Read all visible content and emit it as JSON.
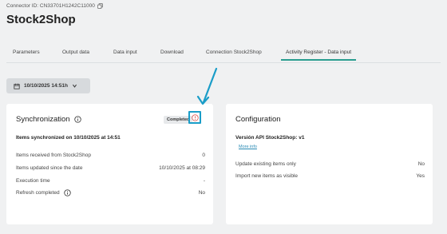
{
  "header": {
    "connector_id": "Connector ID: CN33701H1242C11000",
    "title": "Stock2Shop"
  },
  "tabs": [
    {
      "label": "Parameters"
    },
    {
      "label": "Output data"
    },
    {
      "label": "Data input"
    },
    {
      "label": "Download"
    },
    {
      "label": "Connection Stock2Shop"
    },
    {
      "label": "Activity Register - Data input",
      "active": true
    }
  ],
  "date_button": {
    "label": "10/10/2025 14:51h",
    "icon": "calendar-icon"
  },
  "sync_card": {
    "title": "Synchronization",
    "badge": "Completed",
    "synced_line": "Items synchronized on 10/10/2025 at 14:51",
    "rows": [
      {
        "label": "Items received from Stock2Shop",
        "value": "0"
      },
      {
        "label": "Items updated since the date",
        "value": "10/10/2025 at 08:29"
      },
      {
        "label": "Execution time",
        "value": "-"
      },
      {
        "label": "Refresh completed",
        "value": "No"
      }
    ]
  },
  "config_card": {
    "title": "Configuration",
    "api_version": "Versión API Stock2Shop: v1",
    "more_info": "More info",
    "rows": [
      {
        "label": "Update existing items only",
        "value": "No"
      },
      {
        "label": "Import new items as visible",
        "value": "Yes"
      }
    ]
  },
  "colors": {
    "accent": "#2a9d8f",
    "highlight": "#1a9dc8",
    "warning": "#d9534f"
  }
}
